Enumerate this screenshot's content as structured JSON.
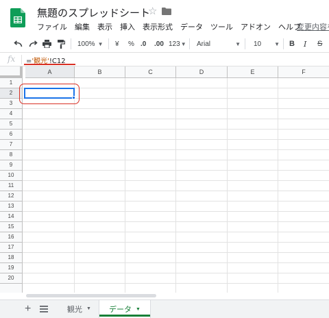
{
  "header": {
    "title": "無題のスプレッドシート",
    "menu": [
      "ファイル",
      "編集",
      "表示",
      "挿入",
      "表示形式",
      "データ",
      "ツール",
      "アドオン",
      "ヘルプ"
    ],
    "changes_link": "変更内容を"
  },
  "toolbar": {
    "zoom": "100%",
    "currency": "¥",
    "percent": "%",
    "decrease_decimal": ".0",
    "increase_decimal": ".00",
    "more_formats": "123",
    "font": "Arial",
    "font_size": "10",
    "bold": "B",
    "italic": "I",
    "strikethrough": "S"
  },
  "formula_bar": {
    "fx": "fx",
    "eq": "=",
    "sheet_ref": "'観光'",
    "cell_ref": "!C12"
  },
  "grid": {
    "columns": [
      "A",
      "B",
      "C",
      "D",
      "E",
      "F"
    ],
    "rows": [
      "1",
      "2",
      "3",
      "4",
      "5",
      "6",
      "7",
      "8",
      "9",
      "10",
      "11",
      "12",
      "13",
      "14",
      "15",
      "16",
      "17",
      "18",
      "19",
      "20"
    ],
    "selected_column": "A",
    "selected_row": "2",
    "active_cell": "A2"
  },
  "sheets": {
    "tabs": [
      {
        "label": "観光",
        "active": false
      },
      {
        "label": "データ",
        "active": true
      }
    ]
  },
  "colors": {
    "accent_blue": "#1a73e8",
    "active_tab_green": "#188038",
    "annotation_red": "#d93025",
    "formula_string": "#c05500"
  }
}
